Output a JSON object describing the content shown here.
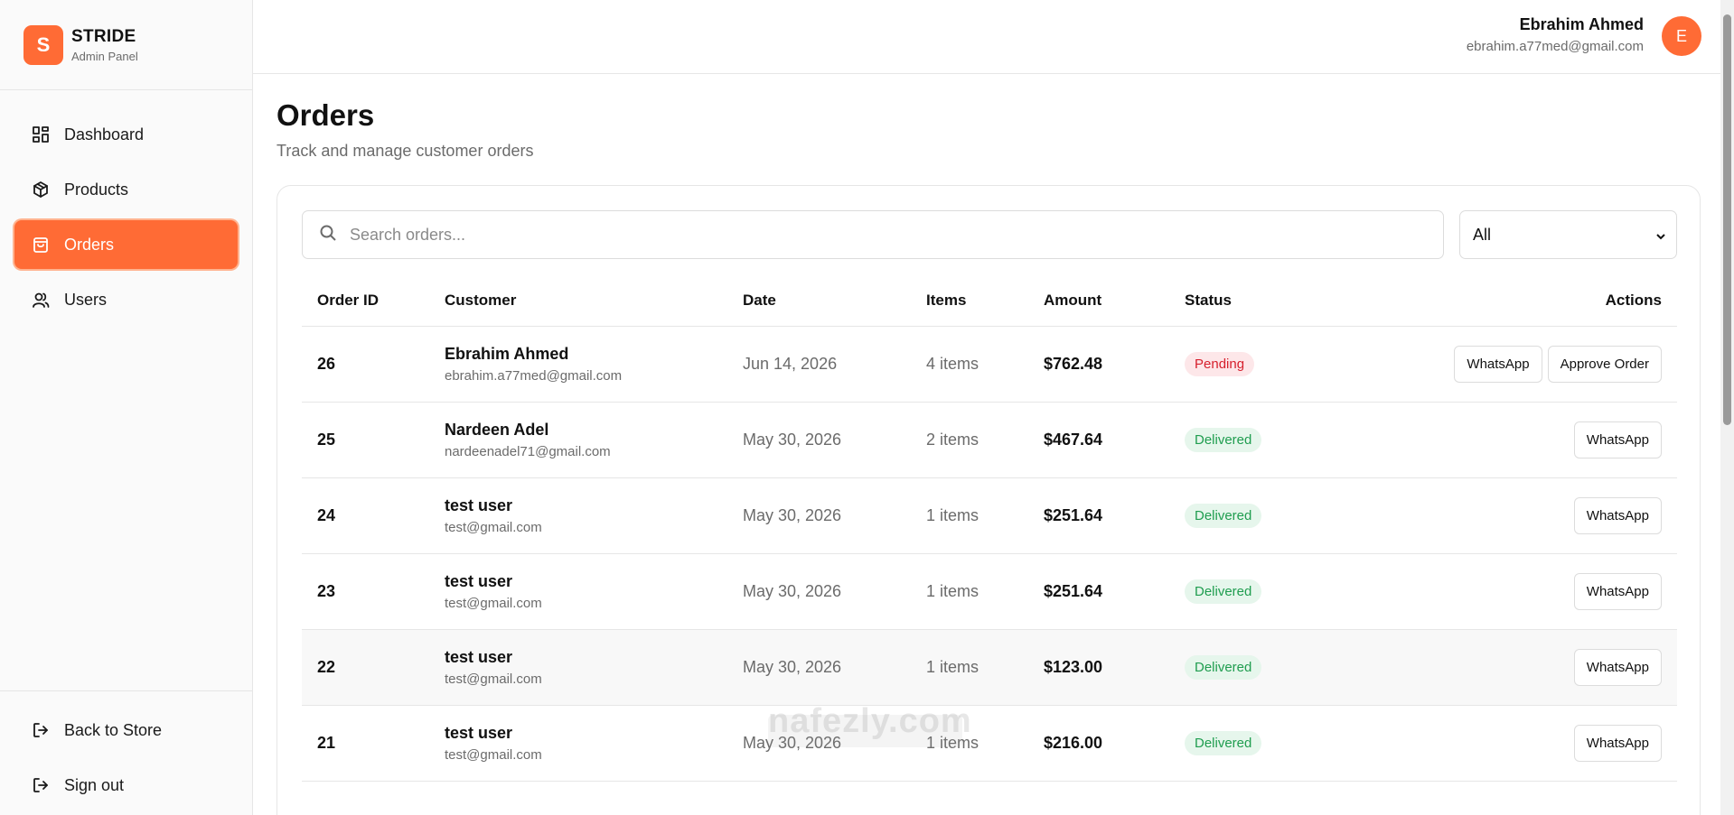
{
  "brand": {
    "logo_letter": "S",
    "name": "STRIDE",
    "subtitle": "Admin Panel"
  },
  "sidebar": {
    "items": [
      {
        "label": "Dashboard",
        "icon": "dashboard-icon",
        "active": false
      },
      {
        "label": "Products",
        "icon": "box-icon",
        "active": false
      },
      {
        "label": "Orders",
        "icon": "shopping-bag-icon",
        "active": true
      },
      {
        "label": "Users",
        "icon": "users-icon",
        "active": false
      }
    ],
    "bottom": [
      {
        "label": "Back to Store",
        "icon": "logout-icon"
      },
      {
        "label": "Sign out",
        "icon": "logout-icon"
      }
    ]
  },
  "header": {
    "user_name": "Ebrahim Ahmed",
    "user_email": "ebrahim.a77med@gmail.com",
    "avatar_letter": "E"
  },
  "page": {
    "title": "Orders",
    "subtitle": "Track and manage customer orders"
  },
  "filters": {
    "search_placeholder": "Search orders...",
    "status_selected": "All"
  },
  "table": {
    "headers": [
      "Order ID",
      "Customer",
      "Date",
      "Items",
      "Amount",
      "Status",
      "Actions"
    ],
    "rows": [
      {
        "id": "26",
        "name": "Ebrahim Ahmed",
        "email": "ebrahim.a77med@gmail.com",
        "date": "Jun 14, 2026",
        "items": "4 items",
        "amount": "$762.48",
        "status": "Pending",
        "actions": [
          "WhatsApp",
          "Approve Order"
        ]
      },
      {
        "id": "25",
        "name": "Nardeen Adel",
        "email": "nardeenadel71@gmail.com",
        "date": "May 30, 2026",
        "items": "2 items",
        "amount": "$467.64",
        "status": "Delivered",
        "actions": [
          "WhatsApp"
        ]
      },
      {
        "id": "24",
        "name": "test user",
        "email": "test@gmail.com",
        "date": "May 30, 2026",
        "items": "1 items",
        "amount": "$251.64",
        "status": "Delivered",
        "actions": [
          "WhatsApp"
        ]
      },
      {
        "id": "23",
        "name": "test user",
        "email": "test@gmail.com",
        "date": "May 30, 2026",
        "items": "1 items",
        "amount": "$251.64",
        "status": "Delivered",
        "actions": [
          "WhatsApp"
        ]
      },
      {
        "id": "22",
        "name": "test user",
        "email": "test@gmail.com",
        "date": "May 30, 2026",
        "items": "1 items",
        "amount": "$123.00",
        "status": "Delivered",
        "actions": [
          "WhatsApp"
        ]
      },
      {
        "id": "21",
        "name": "test user",
        "email": "test@gmail.com",
        "date": "May 30, 2026",
        "items": "1 items",
        "amount": "$216.00",
        "status": "Delivered",
        "actions": [
          "WhatsApp"
        ]
      }
    ]
  },
  "watermark": "nafezly.com",
  "colors": {
    "accent": "#ff6b35",
    "pending_bg": "#fde7e9",
    "pending_text": "#d61f2c",
    "delivered_bg": "#e6f6ec",
    "delivered_text": "#1f9d4f"
  }
}
